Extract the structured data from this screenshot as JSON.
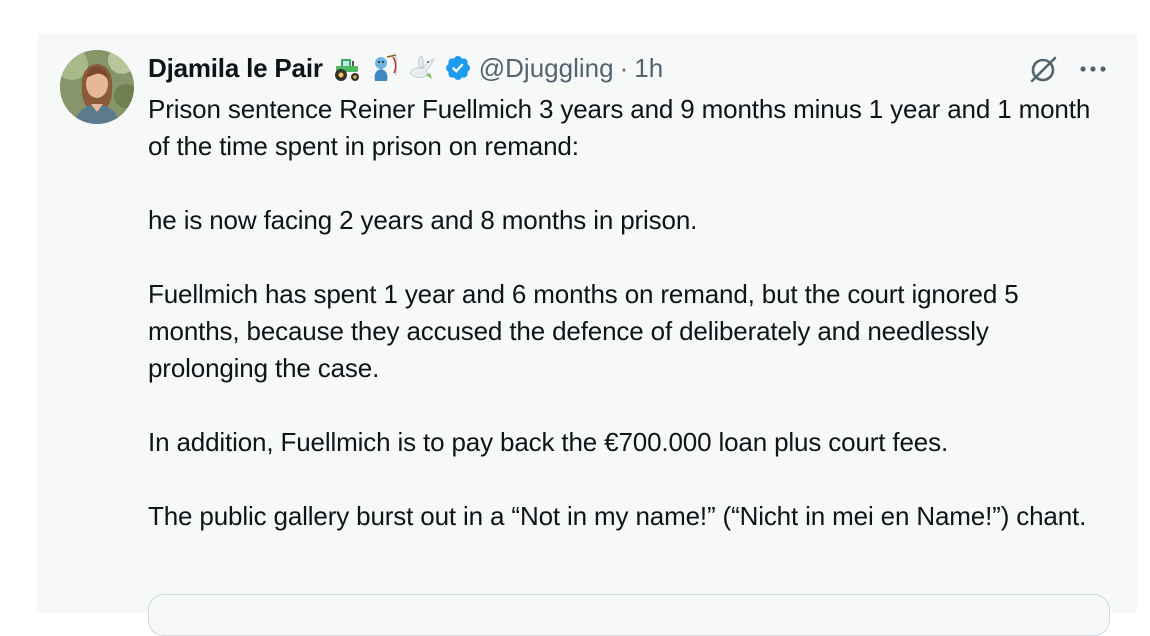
{
  "tweet": {
    "display_name": "Djamila le Pair",
    "name_emojis": [
      "tractor-emoji",
      "fishing-man-emoji",
      "dove-emoji"
    ],
    "handle": "@Djuggling",
    "separator": "·",
    "time": "1h",
    "paragraphs": [
      "Prison sentence Reiner Fuellmich 3 years and 9 months minus 1 year and 1 month of the time spent in prison on remand:",
      "he is now facing 2 years and 8 months in prison.",
      "Fuellmich has spent 1 year and 6 months on remand, but the court ignored 5 months, because they accused the defence of deliberately and needlessly prolonging the case.",
      "In addition, Fuellmich is to pay back the €700.000 loan plus court fees.",
      "The public gallery burst out in a “Not in my name!” (“Nicht in mei en Name!”) chant."
    ]
  },
  "icons": {
    "verified": "verified-badge-icon",
    "grok": "grok-icon",
    "more": "more-icon"
  },
  "colors": {
    "card_background": "#f7f9f9",
    "text": "#0f1419",
    "secondary_text": "#536471",
    "verified_blue": "#1d9bf0"
  }
}
